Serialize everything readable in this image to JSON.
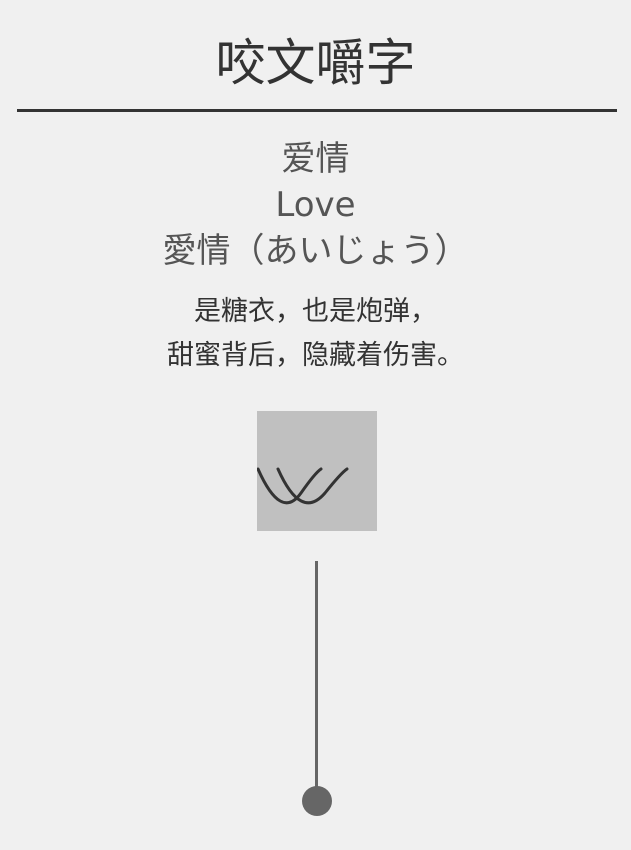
{
  "header": {
    "title": "咬文嚼字"
  },
  "word": {
    "chinese": "爱情",
    "english": "Love",
    "japanese": "愛情（あいじょう）"
  },
  "poem": {
    "lines": [
      "是糖衣，也是炮弹，",
      "甜蜜背后，隐藏着伤害。"
    ]
  },
  "icons": {
    "emoji_box": "smile-eyes-icon",
    "pull_cord": "pull-cord-icon"
  },
  "colors": {
    "background": "#f0f0f0",
    "text": "#333333",
    "muted_text": "#555555",
    "box": "#c0c0c0",
    "cord": "#666666"
  }
}
